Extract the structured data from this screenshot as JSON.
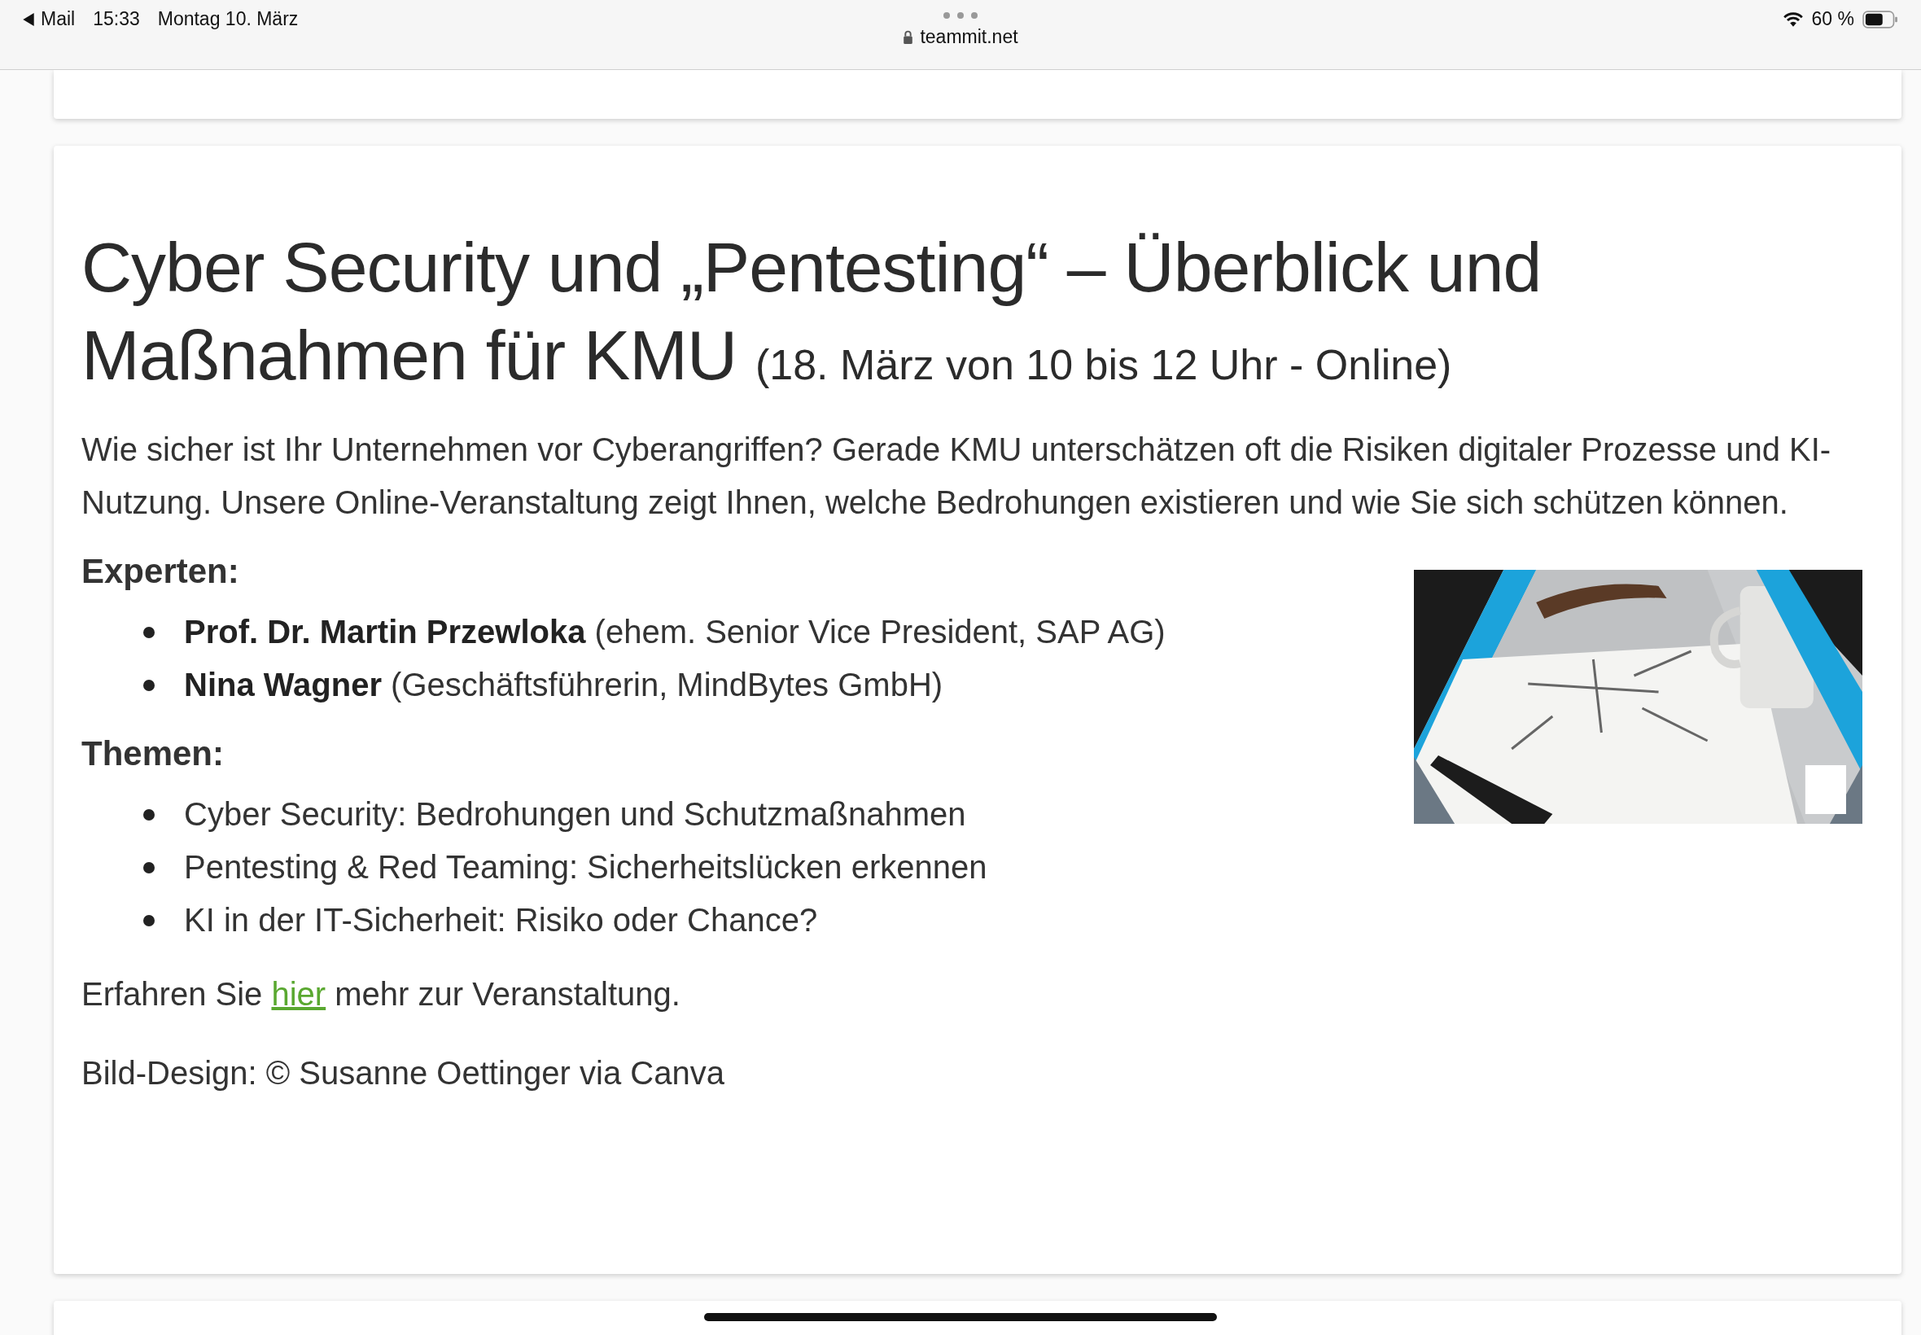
{
  "status_bar": {
    "back_label": "Mail",
    "time": "15:33",
    "date": "Montag 10. März",
    "battery": "60 %"
  },
  "address_bar": {
    "url": "teammit.net"
  },
  "article": {
    "title": "Cyber Security und „Pentesting“ – Überblick und Maßnahmen für KMU",
    "title_note": "(18. März von 10 bis 12 Uhr - Online)",
    "intro": "Wie sicher ist Ihr Unternehmen vor Cyberangriffen? Gerade KMU unterschätzen oft die Risiken digitaler Prozesse und KI-Nutzung. Unsere Online-Veranstaltung zeigt Ihnen, welche Bedrohungen existieren und wie Sie sich schützen können.",
    "sections": [
      {
        "kind": "people",
        "heading": "Experten:",
        "items": [
          {
            "name": "Prof. Dr. Martin Przewloka",
            "detail": "(ehem. Senior Vice President, SAP AG)"
          },
          {
            "name": "Nina Wagner",
            "detail": "(Geschäftsführerin, MindBytes GmbH)"
          }
        ]
      },
      {
        "kind": "topics",
        "heading": "Themen:",
        "items": [
          {
            "text": "Cyber Security: Bedrohungen und Schutzmaßnahmen"
          },
          {
            "text": "Pentesting & Red Teaming: Sicherheitslücken erkennen"
          },
          {
            "text": "KI in der IT-Sicherheit: Risiko oder Chance?"
          }
        ]
      }
    ],
    "more": {
      "before": "Erfahren Sie",
      "link": "hier",
      "after": "mehr zur Veranstaltung."
    },
    "credit": "Bild-Design: © Susanne Oettinger via Canva"
  }
}
